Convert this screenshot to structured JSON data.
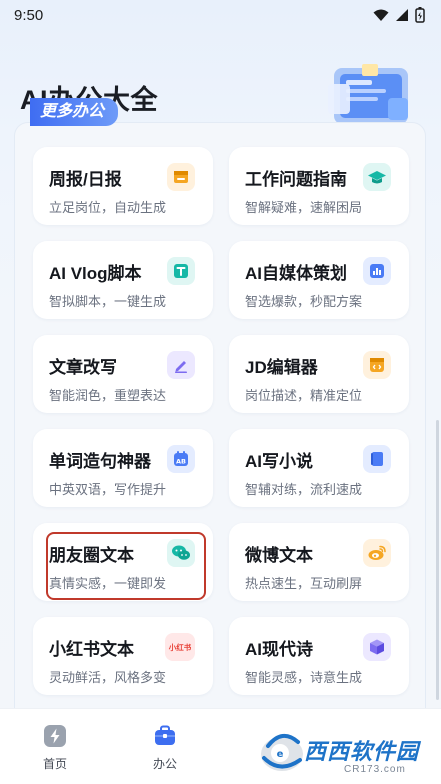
{
  "status": {
    "time": "9:50"
  },
  "header": {
    "title": "AI办公大全",
    "section_tag": "更多办公"
  },
  "cards": [
    {
      "title": "周报/日报",
      "subtitle": "立足岗位，自动生成",
      "icon": "report-icon",
      "icon_bg": "#fff1dd",
      "icon_color": "#f5a623"
    },
    {
      "title": "工作问题指南",
      "subtitle": "智解疑难，速解困局",
      "icon": "graduation-cap-icon",
      "icon_bg": "#dff6f3",
      "icon_color": "#16b8a6"
    },
    {
      "title": "AI Vlog脚本",
      "subtitle": "智拟脚本，一键生成",
      "icon": "t-script-icon",
      "icon_bg": "#dff6f3",
      "icon_color": "#16b8a6"
    },
    {
      "title": "AI自媒体策划",
      "subtitle": "智选爆款，秒配方案",
      "icon": "chart-icon",
      "icon_bg": "#e4ecff",
      "icon_color": "#4a7bf5"
    },
    {
      "title": "文章改写",
      "subtitle": "智能润色，重塑表达",
      "icon": "pen-icon",
      "icon_bg": "#ece8ff",
      "icon_color": "#7d6cf0"
    },
    {
      "title": "JD编辑器",
      "subtitle": "岗位描述，精准定位",
      "icon": "code-doc-icon",
      "icon_bg": "#fff1dd",
      "icon_color": "#f5a623"
    },
    {
      "title": "单词造句神器",
      "subtitle": "中英双语，写作提升",
      "icon": "ab-calendar-icon",
      "icon_bg": "#e4ecff",
      "icon_color": "#4a7bf5"
    },
    {
      "title": "AI写小说",
      "subtitle": "智辅对练，流利速成",
      "icon": "book-icon",
      "icon_bg": "#e4ecff",
      "icon_color": "#4a7bf5"
    },
    {
      "title": "朋友圈文本",
      "subtitle": "真情实感，一键即发",
      "icon": "wechat-icon",
      "icon_bg": "#dff6f3",
      "icon_color": "#16b8a6"
    },
    {
      "title": "微博文本",
      "subtitle": "热点速生，互动刷屏",
      "icon": "weibo-icon",
      "icon_bg": "#fff1dd",
      "icon_color": "#f5a623"
    },
    {
      "title": "小红书文本",
      "subtitle": "灵动鲜活，风格多变",
      "icon": "xiaohongshu-icon",
      "icon_bg": "#ffe8e8",
      "icon_color": "#e8443a",
      "icon_text": "小红书"
    },
    {
      "title": "AI现代诗",
      "subtitle": "智能灵感，诗意生成",
      "icon": "cube-icon",
      "icon_bg": "#ece8ff",
      "icon_color": "#7d6cf0"
    }
  ],
  "tabs": [
    {
      "label": "首页"
    },
    {
      "label": "办公"
    }
  ],
  "watermark": {
    "brand": "西西软件园",
    "url": "CR173.com"
  }
}
